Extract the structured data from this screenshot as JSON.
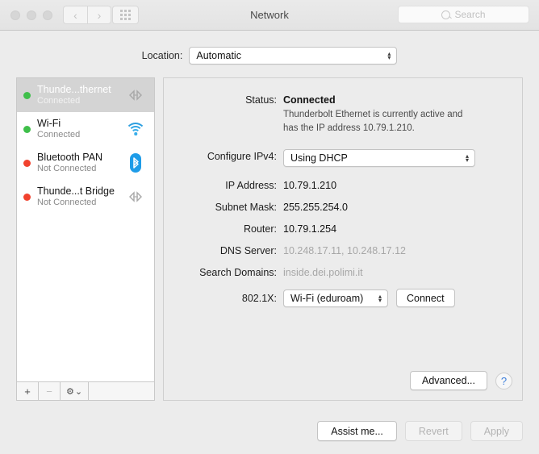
{
  "window": {
    "title": "Network",
    "search_placeholder": "Search"
  },
  "toolbar": {
    "back_glyph": "‹",
    "forward_glyph": "›",
    "grid_name": "show-all-grid"
  },
  "location": {
    "label": "Location:",
    "value": "Automatic"
  },
  "sidebar": {
    "services": [
      {
        "name": "Thunde...thernet",
        "status": "Connected",
        "dot": "#3fbf4a",
        "icon": "thunderbolt-icon",
        "selected": true
      },
      {
        "name": "Wi-Fi",
        "status": "Connected",
        "dot": "#3fbf4a",
        "icon": "wifi-icon",
        "selected": false
      },
      {
        "name": "Bluetooth PAN",
        "status": "Not Connected",
        "dot": "#f1422e",
        "icon": "bluetooth-icon",
        "selected": false
      },
      {
        "name": "Thunde...t Bridge",
        "status": "Not Connected",
        "dot": "#f1422e",
        "icon": "thunderbolt-icon",
        "selected": false
      }
    ],
    "add_label": "+",
    "remove_label": "−",
    "gear_label": "⚙",
    "gear_chevron": "⌄"
  },
  "panel": {
    "status_label": "Status:",
    "status_value": "Connected",
    "status_description": "Thunderbolt Ethernet is currently active and has the IP address 10.79.1.210.",
    "configure_label": "Configure IPv4:",
    "configure_value": "Using DHCP",
    "ip_label": "IP Address:",
    "ip_value": "10.79.1.210",
    "subnet_label": "Subnet Mask:",
    "subnet_value": "255.255.254.0",
    "router_label": "Router:",
    "router_value": "10.79.1.254",
    "dns_label": "DNS Server:",
    "dns_value": "10.248.17.11, 10.248.17.12",
    "search_domains_label": "Search Domains:",
    "search_domains_value": "inside.dei.polimi.it",
    "dot1x_label": "802.1X:",
    "dot1x_value": "Wi-Fi (eduroam)",
    "connect_label": "Connect",
    "advanced_label": "Advanced...",
    "help_label": "?"
  },
  "footer": {
    "assist_label": "Assist me...",
    "revert_label": "Revert",
    "apply_label": "Apply"
  },
  "popup_arrows": {
    "up": "▴",
    "down": "▾"
  }
}
